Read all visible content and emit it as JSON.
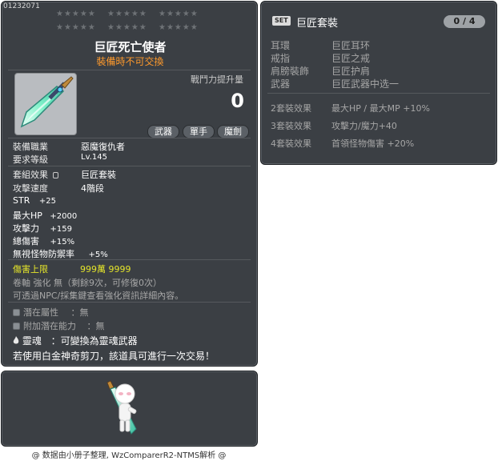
{
  "item": {
    "id": "01232071",
    "stars_label": "★★★★★",
    "name": "巨匠死亡使者",
    "trade_notice": "裝備時不可交換",
    "power_label": "戰鬥力提升量",
    "power_value": "0",
    "tags": [
      "武器",
      "單手",
      "魔劍"
    ],
    "job_label": "裝備職業",
    "job_value": "惡魔復仇者",
    "level_label": "要求等級",
    "level_value": "Lv.145",
    "set_label": "套組效果",
    "set_value": "巨匠套裝",
    "speed_label": "攻擊速度",
    "speed_value": "4階段",
    "stats": [
      {
        "name": "STR",
        "value": "+25"
      },
      {
        "name": "最大HP",
        "value": "+2000"
      },
      {
        "name": "攻擊力",
        "value": "+159"
      },
      {
        "name": "總傷害",
        "value": "+15%"
      },
      {
        "name": "無視怪物防禦率",
        "value": "+5%"
      }
    ],
    "damage_cap_label": "傷害上限",
    "damage_cap_value": "999萬 9999",
    "scroll_info": "卷軸 強化 無（剩餘9次，可修復0次）",
    "npc_info": "可透過NPC/採集鍵查看強化資訊詳細內容。",
    "potential_label": "潛在屬性",
    "potential_value": "：無",
    "bonus_label": "附加潛在能力",
    "bonus_value": "：無",
    "soul_label": "靈魂",
    "soul_value": "：可變換為靈魂武器",
    "trade_info": "若使用白金神奇剪刀，該道具可進行一次交易！"
  },
  "set": {
    "badge": "SET",
    "name": "巨匠套裝",
    "count": "0 / 4",
    "pieces": [
      {
        "slot": "耳環",
        "item": "巨匠耳环"
      },
      {
        "slot": "戒指",
        "item": "巨匠之戒"
      },
      {
        "slot": "肩膀裝飾",
        "item": "巨匠护肩"
      },
      {
        "slot": "武器",
        "item": "巨匠武器中选一"
      }
    ],
    "bonuses": [
      {
        "label": "2套裝效果",
        "effect": "最大HP / 最大MP  +10%"
      },
      {
        "label": "3套裝效果",
        "effect": "攻擊力/魔力+40"
      },
      {
        "label": "4套裝效果",
        "effect": "首領怪物傷害 +20%"
      }
    ]
  },
  "footer": "@ 数据由小册子整理, WzComparerR2-NTMS解析 @",
  "colors": {
    "panel_bg": "#3b3f44",
    "title": "#ffffff",
    "trade_notice": "#ff9a2c",
    "damage_cap": "#e5e52a",
    "muted": "#a6a6a6"
  }
}
